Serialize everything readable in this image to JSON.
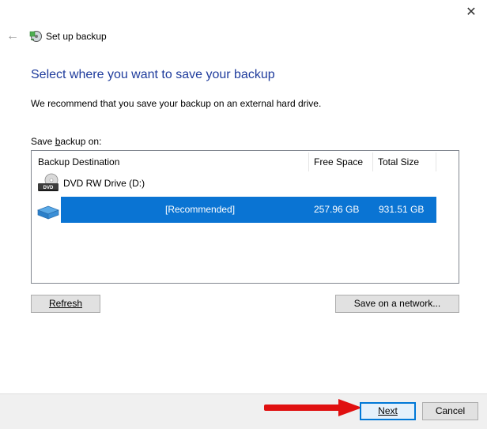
{
  "window": {
    "title": "Set up backup",
    "close_glyph": "✕",
    "back_glyph": "←"
  },
  "main": {
    "heading": "Select where you want to save your backup",
    "description": "We recommend that you save your backup on an external hard drive.",
    "save_label_pre": "Save ",
    "save_label_underlined": "b",
    "save_label_post": "ackup on:"
  },
  "table": {
    "columns": [
      "Backup Destination",
      "Free Space",
      "Total Size"
    ],
    "rows": [
      {
        "name": "DVD RW Drive (D:)",
        "free": "",
        "total": "",
        "icon": "dvd-drive-icon",
        "selected": false
      },
      {
        "name": "[Recommended]",
        "free": "257.96 GB",
        "total": "931.51 GB",
        "icon": "hard-drive-icon",
        "selected": true
      }
    ],
    "dvd_icon_text": "DVD"
  },
  "buttons": {
    "refresh": "Refresh",
    "save_network": "Save on a network...",
    "next": "Next",
    "cancel": "Cancel"
  },
  "colors": {
    "heading": "#1e3b9c",
    "selection": "#0a74d3",
    "arrow": "#e01010",
    "next_border": "#0078d7"
  }
}
